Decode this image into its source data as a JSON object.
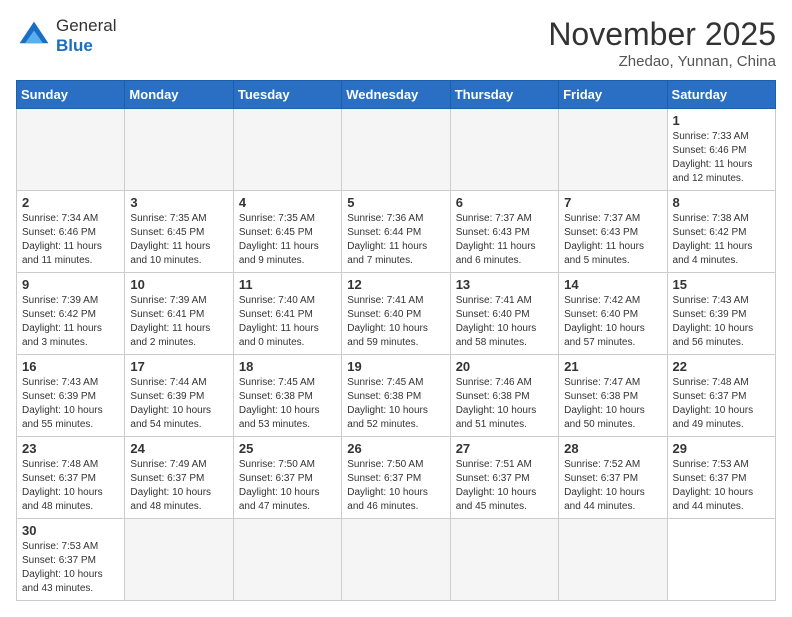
{
  "header": {
    "logo_line1": "General",
    "logo_line2": "Blue",
    "month": "November 2025",
    "location": "Zhedao, Yunnan, China"
  },
  "weekdays": [
    "Sunday",
    "Monday",
    "Tuesday",
    "Wednesday",
    "Thursday",
    "Friday",
    "Saturday"
  ],
  "days": [
    {
      "num": "",
      "info": ""
    },
    {
      "num": "",
      "info": ""
    },
    {
      "num": "",
      "info": ""
    },
    {
      "num": "",
      "info": ""
    },
    {
      "num": "",
      "info": ""
    },
    {
      "num": "",
      "info": ""
    },
    {
      "num": "1",
      "info": "Sunrise: 7:33 AM\nSunset: 6:46 PM\nDaylight: 11 hours\nand 12 minutes."
    },
    {
      "num": "2",
      "info": "Sunrise: 7:34 AM\nSunset: 6:46 PM\nDaylight: 11 hours\nand 11 minutes."
    },
    {
      "num": "3",
      "info": "Sunrise: 7:35 AM\nSunset: 6:45 PM\nDaylight: 11 hours\nand 10 minutes."
    },
    {
      "num": "4",
      "info": "Sunrise: 7:35 AM\nSunset: 6:45 PM\nDaylight: 11 hours\nand 9 minutes."
    },
    {
      "num": "5",
      "info": "Sunrise: 7:36 AM\nSunset: 6:44 PM\nDaylight: 11 hours\nand 7 minutes."
    },
    {
      "num": "6",
      "info": "Sunrise: 7:37 AM\nSunset: 6:43 PM\nDaylight: 11 hours\nand 6 minutes."
    },
    {
      "num": "7",
      "info": "Sunrise: 7:37 AM\nSunset: 6:43 PM\nDaylight: 11 hours\nand 5 minutes."
    },
    {
      "num": "8",
      "info": "Sunrise: 7:38 AM\nSunset: 6:42 PM\nDaylight: 11 hours\nand 4 minutes."
    },
    {
      "num": "9",
      "info": "Sunrise: 7:39 AM\nSunset: 6:42 PM\nDaylight: 11 hours\nand 3 minutes."
    },
    {
      "num": "10",
      "info": "Sunrise: 7:39 AM\nSunset: 6:41 PM\nDaylight: 11 hours\nand 2 minutes."
    },
    {
      "num": "11",
      "info": "Sunrise: 7:40 AM\nSunset: 6:41 PM\nDaylight: 11 hours\nand 0 minutes."
    },
    {
      "num": "12",
      "info": "Sunrise: 7:41 AM\nSunset: 6:40 PM\nDaylight: 10 hours\nand 59 minutes."
    },
    {
      "num": "13",
      "info": "Sunrise: 7:41 AM\nSunset: 6:40 PM\nDaylight: 10 hours\nand 58 minutes."
    },
    {
      "num": "14",
      "info": "Sunrise: 7:42 AM\nSunset: 6:40 PM\nDaylight: 10 hours\nand 57 minutes."
    },
    {
      "num": "15",
      "info": "Sunrise: 7:43 AM\nSunset: 6:39 PM\nDaylight: 10 hours\nand 56 minutes."
    },
    {
      "num": "16",
      "info": "Sunrise: 7:43 AM\nSunset: 6:39 PM\nDaylight: 10 hours\nand 55 minutes."
    },
    {
      "num": "17",
      "info": "Sunrise: 7:44 AM\nSunset: 6:39 PM\nDaylight: 10 hours\nand 54 minutes."
    },
    {
      "num": "18",
      "info": "Sunrise: 7:45 AM\nSunset: 6:38 PM\nDaylight: 10 hours\nand 53 minutes."
    },
    {
      "num": "19",
      "info": "Sunrise: 7:45 AM\nSunset: 6:38 PM\nDaylight: 10 hours\nand 52 minutes."
    },
    {
      "num": "20",
      "info": "Sunrise: 7:46 AM\nSunset: 6:38 PM\nDaylight: 10 hours\nand 51 minutes."
    },
    {
      "num": "21",
      "info": "Sunrise: 7:47 AM\nSunset: 6:38 PM\nDaylight: 10 hours\nand 50 minutes."
    },
    {
      "num": "22",
      "info": "Sunrise: 7:48 AM\nSunset: 6:37 PM\nDaylight: 10 hours\nand 49 minutes."
    },
    {
      "num": "23",
      "info": "Sunrise: 7:48 AM\nSunset: 6:37 PM\nDaylight: 10 hours\nand 48 minutes."
    },
    {
      "num": "24",
      "info": "Sunrise: 7:49 AM\nSunset: 6:37 PM\nDaylight: 10 hours\nand 48 minutes."
    },
    {
      "num": "25",
      "info": "Sunrise: 7:50 AM\nSunset: 6:37 PM\nDaylight: 10 hours\nand 47 minutes."
    },
    {
      "num": "26",
      "info": "Sunrise: 7:50 AM\nSunset: 6:37 PM\nDaylight: 10 hours\nand 46 minutes."
    },
    {
      "num": "27",
      "info": "Sunrise: 7:51 AM\nSunset: 6:37 PM\nDaylight: 10 hours\nand 45 minutes."
    },
    {
      "num": "28",
      "info": "Sunrise: 7:52 AM\nSunset: 6:37 PM\nDaylight: 10 hours\nand 44 minutes."
    },
    {
      "num": "29",
      "info": "Sunrise: 7:53 AM\nSunset: 6:37 PM\nDaylight: 10 hours\nand 44 minutes."
    },
    {
      "num": "30",
      "info": "Sunrise: 7:53 AM\nSunset: 6:37 PM\nDaylight: 10 hours\nand 43 minutes."
    },
    {
      "num": "",
      "info": ""
    },
    {
      "num": "",
      "info": ""
    },
    {
      "num": "",
      "info": ""
    },
    {
      "num": "",
      "info": ""
    },
    {
      "num": "",
      "info": ""
    }
  ]
}
